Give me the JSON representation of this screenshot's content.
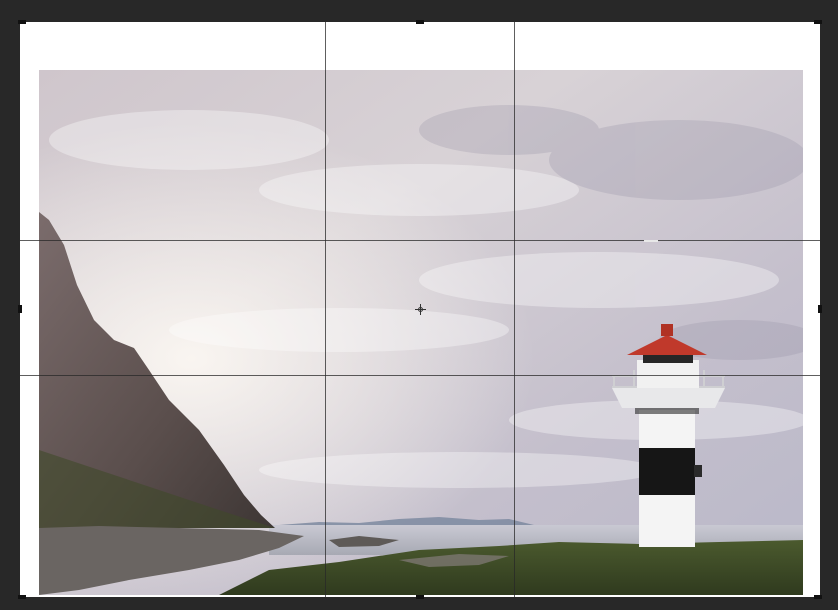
{
  "app": {
    "name": "crop-tool-canvas"
  },
  "icons": {
    "center_marker": "crosshair-icon",
    "handles": "crop-handle-icon"
  },
  "colors": {
    "workspace": "#282828",
    "canvas": "#ffffff",
    "grid_line": "#282828",
    "handle": "#111111",
    "lighthouse_cap": "#c0392b"
  },
  "crop": {
    "grid": "rule-of-thirds"
  }
}
